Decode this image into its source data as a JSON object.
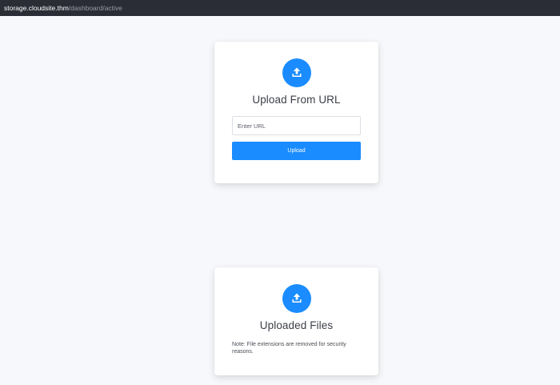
{
  "browser": {
    "url_host": "storage.cloudsite.thm",
    "url_path": "/dashboard/active"
  },
  "upload_card": {
    "icon": "upload-icon",
    "title": "Upload From URL",
    "input_placeholder": "Enter URL",
    "input_value": "",
    "button_label": "Upload"
  },
  "files_card": {
    "icon": "upload-icon",
    "title": "Uploaded Files",
    "note": "Note: File extensions are removed for security reasons."
  },
  "colors": {
    "accent": "#1a8cff",
    "background": "#f7f8fb",
    "url_bar": "#2a2c36"
  }
}
